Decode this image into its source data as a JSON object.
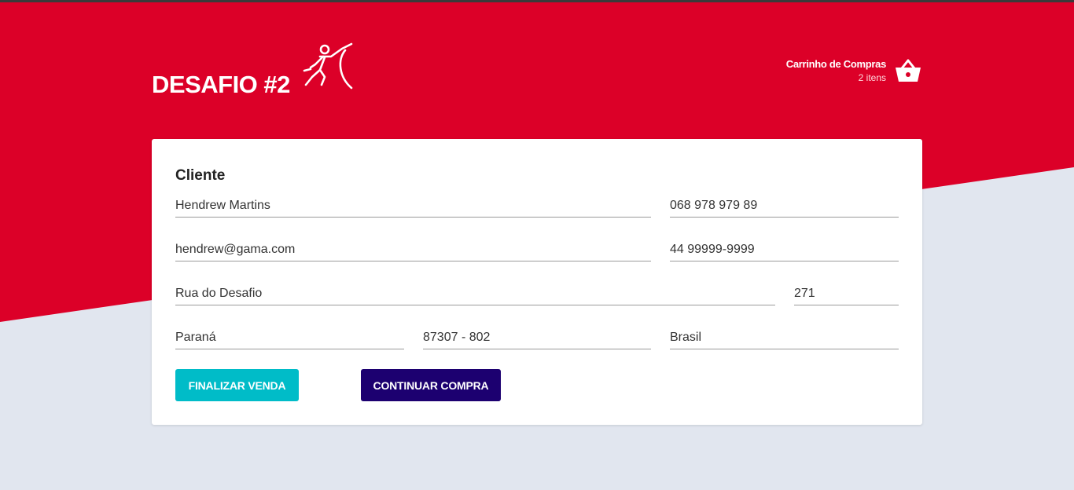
{
  "colors": {
    "brand_red": "#dc0028",
    "background": "#e1e6ef",
    "finalize_button": "#00bcc8",
    "continue_button": "#1c0070"
  },
  "header": {
    "title": "DESAFIO #2",
    "logo_icon": "fencer-icon",
    "cart": {
      "title": "Carrinho de Compras",
      "count": "2 itens",
      "icon": "basket-icon"
    }
  },
  "form": {
    "section_title": "Cliente",
    "fields": {
      "name": "Hendrew Martins",
      "cpf": "068 978 979 89",
      "email": "hendrew@gama.com",
      "phone": "44 99999-9999",
      "street": "Rua do Desafio",
      "number": "271",
      "state": "Paraná",
      "zip": "87307 - 802",
      "country": "Brasil"
    }
  },
  "buttons": {
    "finalize": "FINALIZAR VENDA",
    "continue": "CONTINUAR COMPRA"
  }
}
